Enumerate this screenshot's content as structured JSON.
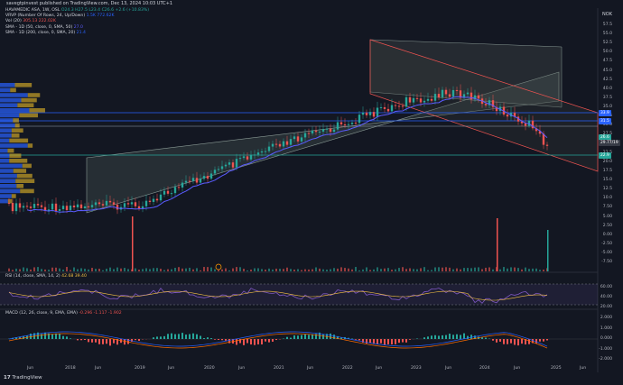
{
  "header": {
    "published": "savegtpinvest published on TradingView.com, Dec 13, 2024 10:03 UTC+1"
  },
  "legend": {
    "symbol_line": "HAVAMEDIC ASA, 1W, OSL",
    "ohlc": "O24.3 H27.5 L23.4 C26.6 +2.6 (+10.83%)",
    "vrvp": "VRVP (Number Of Rows, 24, Up/Down)",
    "vrvp_vals": "1.5K 772.62K",
    "vol": "Vol (20)",
    "vol_vals": "305.13 222.02K",
    "sma50": "SMA - 1D (50, close, 0, SMA, 50)",
    "sma50_val": "27.0",
    "sma200": "SMA - 1D (200, close, 0, SMA, 20)",
    "sma200_val": "21.4"
  },
  "price_axis": {
    "currency": "NOK",
    "ticks": [
      "57.5",
      "55.0",
      "52.5",
      "50.0",
      "47.5",
      "45.0",
      "42.5",
      "40.0",
      "37.5",
      "35.0",
      "32.5",
      "30.0",
      "27.5",
      "25.0",
      "22.5",
      "20.0",
      "17.5",
      "15.0",
      "12.5",
      "10.0",
      "7.50",
      "5.00",
      "2.50",
      "0.00",
      "-2.50",
      "-5.00",
      "-7.50"
    ],
    "tags": [
      {
        "label": "33.9",
        "color": "#2962ff"
      },
      {
        "label": "31.5",
        "color": "#2962ff"
      },
      {
        "label": "26.6",
        "color": "#26a69a"
      },
      {
        "label": "29.77/19",
        "color": "#363a45"
      },
      {
        "label": "22.9",
        "color": "#26a69a"
      }
    ]
  },
  "rsi": {
    "title": "RSI (14, close, SMA, 14, 2)",
    "values": "42.68 39.40",
    "ticks": [
      "60.00",
      "40.00",
      "20.00"
    ]
  },
  "macd": {
    "title": "MACD (12, 26, close, 9, EMA, EMA)",
    "values": "-0.296 -1.117 -1.902",
    "ticks": [
      "2.000",
      "1.000",
      "0.000",
      "-1.000",
      "-2.000"
    ]
  },
  "time_axis": {
    "labels": [
      "Jun",
      "2018",
      "Jun",
      "2019",
      "Jun",
      "2020",
      "Jun",
      "2021",
      "Jun",
      "2022",
      "Jun",
      "2023",
      "Jun",
      "2024",
      "Jun",
      "2025",
      "Jun"
    ]
  },
  "footer": {
    "logo": "TradingView"
  },
  "colors": {
    "background": "#131722",
    "up": "#26a69a",
    "down": "#ef5350",
    "sma": "#5b5bff",
    "rsi": "#7e57c2",
    "macd_line": "#2962ff",
    "signal_line": "#ff6d00"
  }
}
